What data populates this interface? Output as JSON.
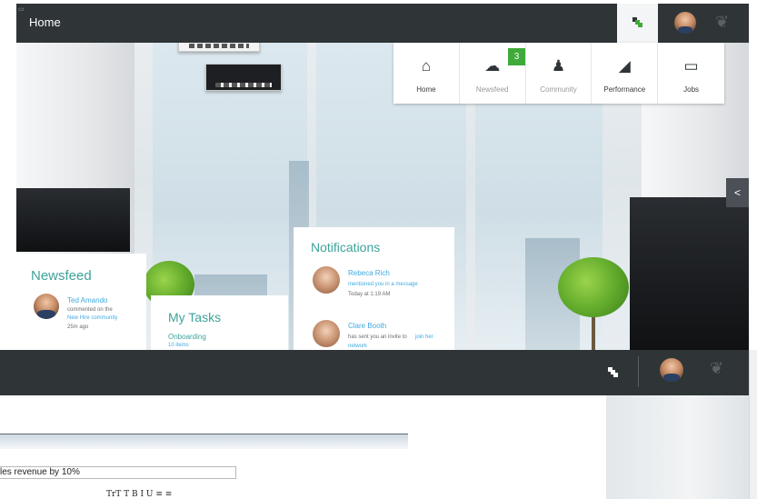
{
  "header": {
    "title": "Home",
    "nav": [
      {
        "label": "Home",
        "icon": "home-icon"
      },
      {
        "label": "Newsfeed",
        "icon": "chat-bubbles-icon",
        "badge": "3"
      },
      {
        "label": "Community",
        "icon": "people-icon"
      },
      {
        "label": "Performance",
        "icon": "chart-icon"
      },
      {
        "label": "Jobs",
        "icon": "laptop-icon"
      }
    ]
  },
  "newsfeed": {
    "title": "Newsfeed",
    "items": [
      {
        "name": "Ted Amando",
        "line1": "commented on the",
        "link": "New Hire community",
        "time": "25m ago"
      }
    ]
  },
  "tasks": {
    "title": "My Tasks",
    "items": [
      {
        "label": "Onboarding",
        "sub": "10 items"
      }
    ]
  },
  "notifications": {
    "title": "Notifications",
    "items": [
      {
        "name": "Rebeca Rich",
        "text": "mentioned you in a message",
        "time": "Today at 1:19 AM"
      },
      {
        "name": "Clare Booth",
        "text": "has sent you an invite to",
        "link": "join her",
        "link2": "network"
      }
    ]
  },
  "lower": {
    "field_value": "les revenue by 10%",
    "toolbar_text": "TrT T B I U ≡ ≡"
  },
  "colors": {
    "accent": "#3ea39a",
    "header": "#2f3437",
    "badge": "#3faa3a",
    "link": "#3fa9e0"
  }
}
